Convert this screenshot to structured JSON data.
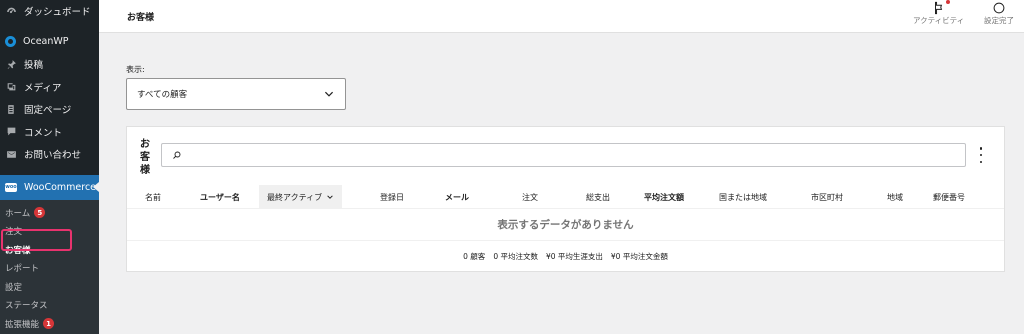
{
  "sidebar": {
    "items": [
      {
        "label": "ダッシュボード",
        "icon": "dashboard-icon"
      },
      {
        "label": "OceanWP",
        "icon": "oceanwp-icon"
      },
      {
        "label": "投稿",
        "icon": "pin-icon"
      },
      {
        "label": "メディア",
        "icon": "media-icon"
      },
      {
        "label": "固定ページ",
        "icon": "page-icon"
      },
      {
        "label": "コメント",
        "icon": "comment-icon"
      },
      {
        "label": "お問い合わせ",
        "icon": "mail-icon"
      }
    ],
    "woocommerce": {
      "label": "WooCommerce",
      "logo_text": "woo"
    },
    "submenu": [
      {
        "label": "ホーム",
        "badge": "5"
      },
      {
        "label": "注文"
      },
      {
        "label": "お客様"
      },
      {
        "label": "レポート"
      },
      {
        "label": "設定"
      },
      {
        "label": "ステータス"
      },
      {
        "label": "拡張機能",
        "badge": "1"
      }
    ]
  },
  "header": {
    "title": "お客様",
    "activity_label": "アクティビティ",
    "setup_label": "設定完了"
  },
  "view": {
    "label": "表示:",
    "selected": "すべての顧客"
  },
  "card": {
    "title": "お客様",
    "columns": [
      "名前",
      "ユーザー名",
      "最終アクティブ",
      "登録日",
      "メール",
      "注文",
      "総支出",
      "平均注文額",
      "国または地域",
      "市区町村",
      "地域",
      "郵便番号"
    ],
    "empty_message": "表示するデータがありません",
    "summary": [
      "0 顧客",
      "0 平均注文数",
      "¥0 平均生涯支出",
      "¥0 平均注文金額"
    ]
  },
  "colors": {
    "sidebar_bg": "#1d2327",
    "accent": "#2271b1",
    "badge": "#d63638",
    "highlight": "#e8336e"
  }
}
